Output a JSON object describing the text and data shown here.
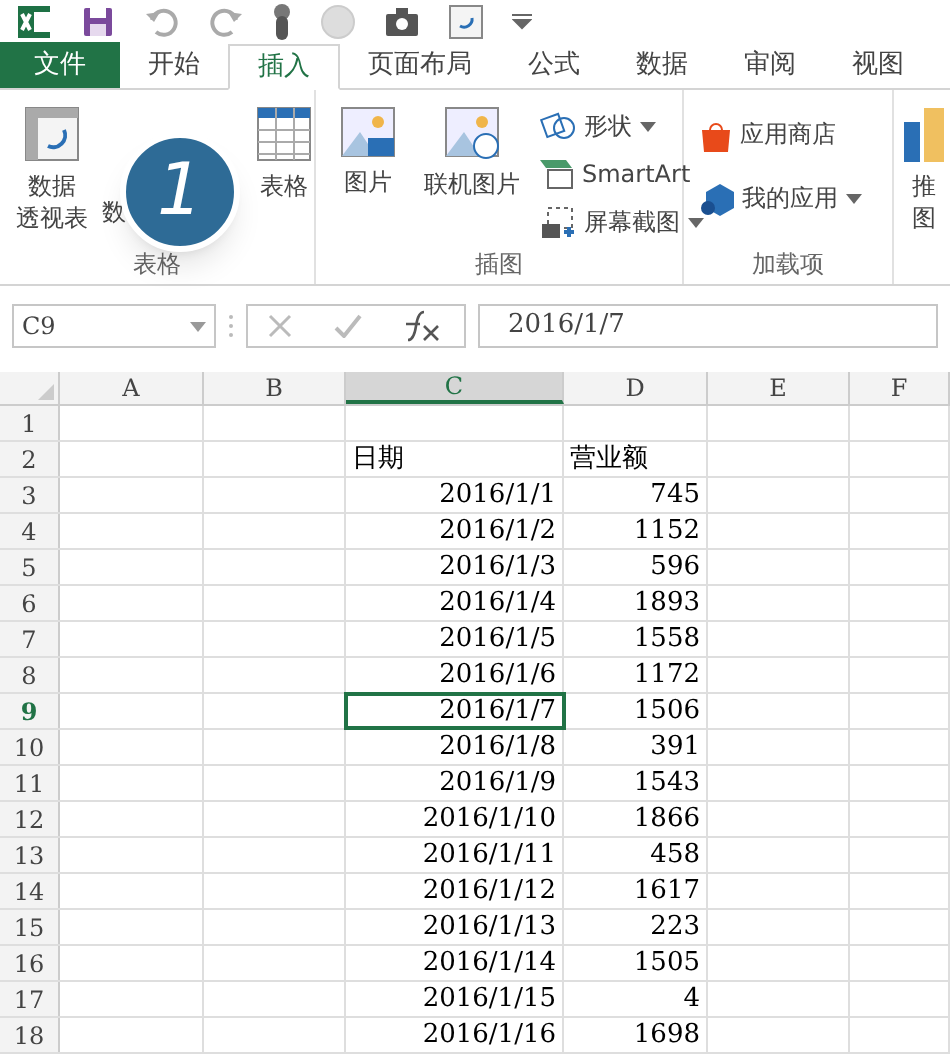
{
  "tabs": [
    {
      "label": "文件",
      "kind": "file",
      "selected": false
    },
    {
      "label": "开始",
      "kind": "tab",
      "selected": false
    },
    {
      "label": "插入",
      "kind": "tab",
      "selected": true
    },
    {
      "label": "页面布局",
      "kind": "tab",
      "selected": false
    },
    {
      "label": "公式",
      "kind": "tab",
      "selected": false
    },
    {
      "label": "数据",
      "kind": "tab",
      "selected": false
    },
    {
      "label": "审阅",
      "kind": "tab",
      "selected": false
    },
    {
      "label": "视图",
      "kind": "tab",
      "selected": false
    }
  ],
  "ribbon_groups": [
    {
      "label": "表格",
      "buttons": [
        {
          "lines": [
            "数据",
            "透视表"
          ]
        },
        {
          "lines": [
            "数"
          ]
        },
        {
          "lines": [
            "表格"
          ]
        }
      ]
    },
    {
      "label": "插图",
      "buttons": [
        {
          "lines": [
            "图片"
          ]
        },
        {
          "lines": [
            "联机图片"
          ]
        }
      ],
      "small_buttons": [
        {
          "label": "形状",
          "dropdown": true
        },
        {
          "label": "SmartArt",
          "dropdown": false
        },
        {
          "label": "屏幕截图",
          "dropdown": true
        }
      ]
    },
    {
      "label": "加载项",
      "small_buttons": [
        {
          "label": "应用商店",
          "dropdown": false
        },
        {
          "label": "我的应用",
          "dropdown": true
        }
      ]
    },
    {
      "buttons": [
        {
          "lines": [
            "推",
            "图"
          ]
        }
      ]
    }
  ],
  "step_badge": "1",
  "name_box": "C9",
  "formula": "2016/1/7",
  "columns": [
    {
      "label": "A",
      "selected": false
    },
    {
      "label": "B",
      "selected": false
    },
    {
      "label": "C",
      "selected": true
    },
    {
      "label": "D",
      "selected": false
    },
    {
      "label": "E",
      "selected": false
    },
    {
      "label": "F",
      "selected": false
    }
  ],
  "rows": [
    {
      "number": "1",
      "selected": false
    },
    {
      "number": "2",
      "selected": false,
      "date": "日期",
      "amount": "营业额",
      "header": true
    },
    {
      "number": "3",
      "selected": false,
      "date": "2016/1/1",
      "amount": "745"
    },
    {
      "number": "4",
      "selected": false,
      "date": "2016/1/2",
      "amount": "1152"
    },
    {
      "number": "5",
      "selected": false,
      "date": "2016/1/3",
      "amount": "596"
    },
    {
      "number": "6",
      "selected": false,
      "date": "2016/1/4",
      "amount": "1893"
    },
    {
      "number": "7",
      "selected": false,
      "date": "2016/1/5",
      "amount": "1558"
    },
    {
      "number": "8",
      "selected": false,
      "date": "2016/1/6",
      "amount": "1172"
    },
    {
      "number": "9",
      "selected": true,
      "date": "2016/1/7",
      "amount": "1506"
    },
    {
      "number": "10",
      "selected": false,
      "date": "2016/1/8",
      "amount": "391"
    },
    {
      "number": "11",
      "selected": false,
      "date": "2016/1/9",
      "amount": "1543"
    },
    {
      "number": "12",
      "selected": false,
      "date": "2016/1/10",
      "amount": "1866"
    },
    {
      "number": "13",
      "selected": false,
      "date": "2016/1/11",
      "amount": "458"
    },
    {
      "number": "14",
      "selected": false,
      "date": "2016/1/12",
      "amount": "1617"
    },
    {
      "number": "15",
      "selected": false,
      "date": "2016/1/13",
      "amount": "223"
    },
    {
      "number": "16",
      "selected": false,
      "date": "2016/1/14",
      "amount": "1505"
    },
    {
      "number": "17",
      "selected": false,
      "date": "2016/1/15",
      "amount": "4"
    },
    {
      "number": "18",
      "selected": false,
      "date": "2016/1/16",
      "amount": "1698"
    }
  ]
}
